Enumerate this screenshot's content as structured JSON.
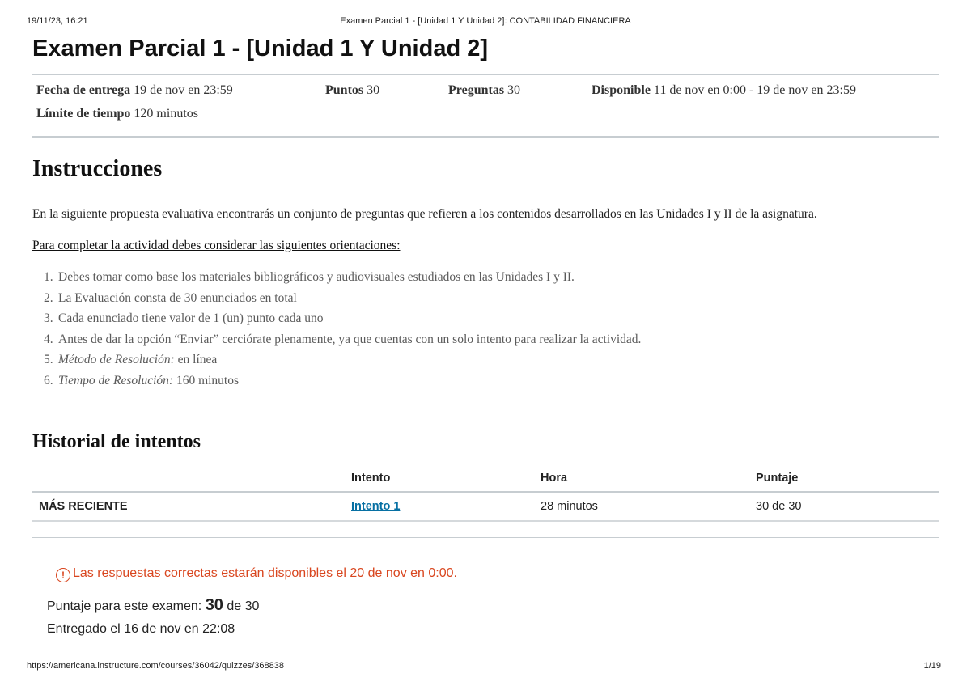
{
  "print_header": {
    "datetime": "19/11/23, 16:21",
    "doc_title": "Examen Parcial 1 - [Unidad 1 Y Unidad 2]: CONTABILIDAD FINANCIERA"
  },
  "quiz": {
    "title": "Examen Parcial 1 - [Unidad 1 Y Unidad 2]",
    "details": {
      "due_label": "Fecha de entrega",
      "due_value": "19 de nov en 23:59",
      "points_label": "Puntos",
      "points_value": "30",
      "questions_label": "Preguntas",
      "questions_value": "30",
      "available_label": "Disponible",
      "available_value": "11 de nov en 0:00 - 19 de nov en 23:59",
      "time_limit_label": "Límite de tiempo",
      "time_limit_value": "120 minutos"
    }
  },
  "instructions": {
    "heading": "Instrucciones",
    "intro": "En la siguiente propuesta evaluativa encontrarás un conjunto de preguntas que refieren a los contenidos desarrollados en las Unidades I y II de la asignatura.",
    "guidelines_heading": "Para completar la actividad debes considerar las siguientes orientaciones:",
    "items": [
      {
        "num": "1.",
        "text": "Debes tomar como base los materiales bibliográficos y audiovisuales estudiados en las Unidades I y II."
      },
      {
        "num": "2.",
        "text": "La Evaluación consta de 30 enunciados en total"
      },
      {
        "num": "3.",
        "text": "Cada enunciado tiene valor de 1 (un) punto cada uno"
      },
      {
        "num": "4.",
        "text": "Antes de dar la opción “Enviar” cerciórate plenamente, ya que cuentas con un solo intento para realizar la actividad."
      },
      {
        "num": "5.",
        "label": "Método de Resolución:",
        "text": "en línea"
      },
      {
        "num": "6.",
        "label": "Tiempo de Resolución:",
        "text": "160 minutos"
      }
    ]
  },
  "history": {
    "heading": "Historial de intentos",
    "columns": [
      "",
      "Intento",
      "Hora",
      "Puntaje"
    ],
    "rows": [
      {
        "label": "MÁS RECIENTE",
        "attempt": "Intento 1",
        "time": "28 minutos",
        "score": "30 de 30"
      }
    ]
  },
  "result": {
    "notice": "Las respuestas correctas estarán disponibles el 20 de nov en 0:00.",
    "score_prefix": "Puntaje para este examen:",
    "score_value": "30",
    "score_suffix": "de 30",
    "submitted": "Entregado el 16 de nov en 22:08"
  },
  "footer": {
    "url": "https://americana.instructure.com/courses/36042/quizzes/368838",
    "page": "1/19"
  },
  "colors": {
    "link": "#0770a3",
    "warning": "#d9461f",
    "divider": "#c7cdd1"
  },
  "icons": {
    "notice_icon": "warning-circle-icon"
  }
}
